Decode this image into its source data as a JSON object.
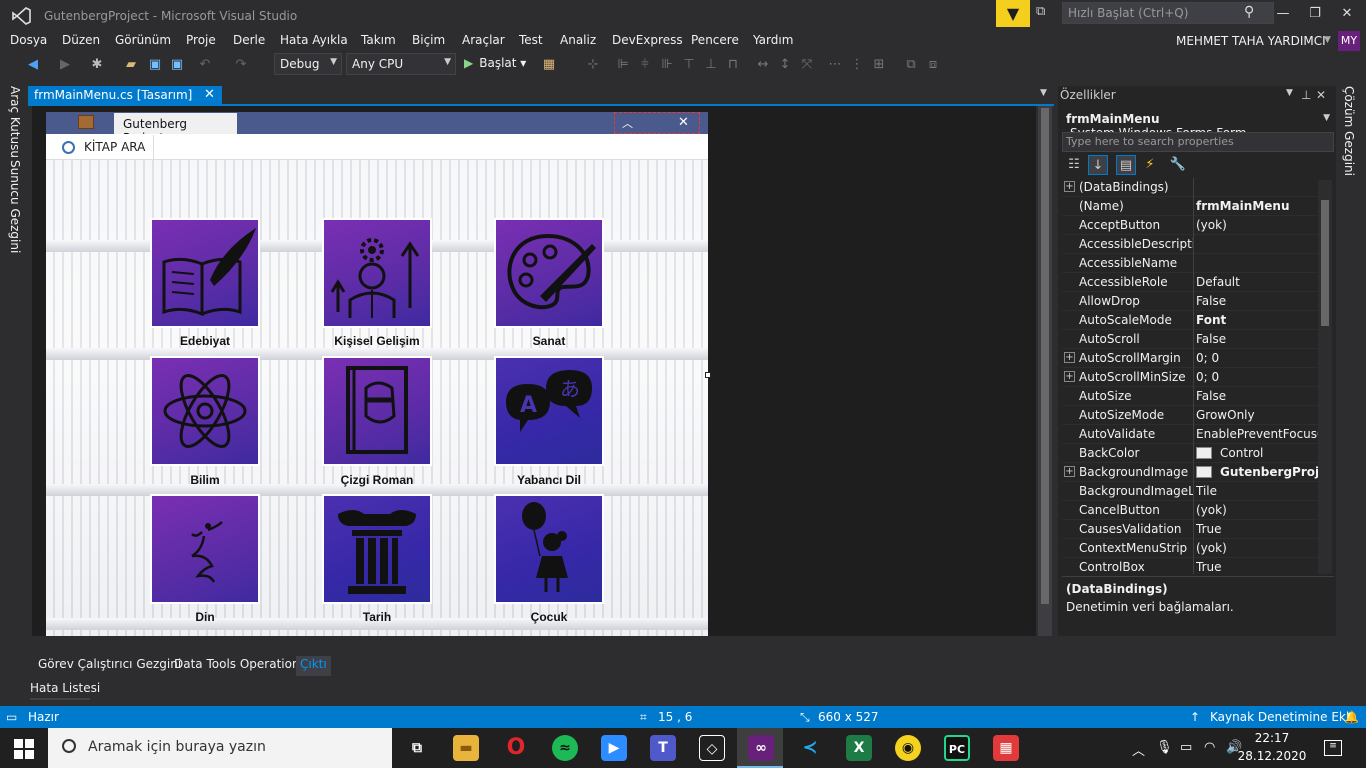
{
  "window": {
    "title": "GutenbergProject - Microsoft Visual Studio",
    "quick_launch_placeholder": "Hızlı Başlat (Ctrl+Q)",
    "user_name": "MEHMET TAHA YARDIMCI",
    "user_initials": "MY"
  },
  "menu": [
    "Dosya",
    "Düzen",
    "Görünüm",
    "Proje",
    "Derle",
    "Hata Ayıkla",
    "Takım",
    "Biçim",
    "Araçlar",
    "Test",
    "Analiz",
    "DevExpress",
    "Pencere",
    "Yardım"
  ],
  "toolbar": {
    "config": "Debug",
    "platform": "Any CPU",
    "run_label": "Başlat"
  },
  "side_tabs": {
    "left": [
      "Araç Kutusu",
      "Sunucu Gezgini"
    ],
    "right": [
      "Çözüm Gezgini"
    ]
  },
  "document_tab": {
    "label": "frmMainMenu.cs [Tasarım]"
  },
  "form": {
    "tab_title": "Gutenberg Project",
    "search_button": "KİTAP ARA",
    "categories": [
      {
        "label": "Edebiyat",
        "icon": "book-quill-icon"
      },
      {
        "label": "Kişisel Gelişim",
        "icon": "personal-growth-icon"
      },
      {
        "label": "Sanat",
        "icon": "palette-icon"
      },
      {
        "label": "Bilim",
        "icon": "atom-icon"
      },
      {
        "label": "Çizgi Roman",
        "icon": "comic-book-icon"
      },
      {
        "label": "Yabancı Dil",
        "icon": "language-bubbles-icon"
      },
      {
        "label": "Din",
        "icon": "whirling-dervish-icon"
      },
      {
        "label": "Tarih",
        "icon": "column-icon"
      },
      {
        "label": "Çocuk",
        "icon": "child-balloon-icon"
      }
    ]
  },
  "properties": {
    "header": "Özellikler",
    "object_name": "frmMainMenu",
    "object_type": "System.Windows.Forms.Form",
    "search_placeholder": "Type here to search properties",
    "rows": [
      {
        "name": "(DataBindings)",
        "value": "",
        "expandable": true
      },
      {
        "name": "(Name)",
        "value": "frmMainMenu",
        "bold": true
      },
      {
        "name": "AcceptButton",
        "value": "(yok)"
      },
      {
        "name": "AccessibleDescription",
        "value": ""
      },
      {
        "name": "AccessibleName",
        "value": ""
      },
      {
        "name": "AccessibleRole",
        "value": "Default"
      },
      {
        "name": "AllowDrop",
        "value": "False"
      },
      {
        "name": "AutoScaleMode",
        "value": "Font",
        "bold": true
      },
      {
        "name": "AutoScroll",
        "value": "False"
      },
      {
        "name": "AutoScrollMargin",
        "value": "0; 0",
        "expandable": true
      },
      {
        "name": "AutoScrollMinSize",
        "value": "0; 0",
        "expandable": true
      },
      {
        "name": "AutoSize",
        "value": "False"
      },
      {
        "name": "AutoSizeMode",
        "value": "GrowOnly"
      },
      {
        "name": "AutoValidate",
        "value": "EnablePreventFocusChange"
      },
      {
        "name": "BackColor",
        "value": "Control",
        "swatch": true
      },
      {
        "name": "BackgroundImage",
        "value": "GutenbergProject",
        "swatch": true,
        "bold": true,
        "expandable": true
      },
      {
        "name": "BackgroundImageLayout",
        "value": "Tile"
      },
      {
        "name": "CancelButton",
        "value": "(yok)"
      },
      {
        "name": "CausesValidation",
        "value": "True"
      },
      {
        "name": "ContextMenuStrip",
        "value": "(yok)"
      },
      {
        "name": "ControlBox",
        "value": "True"
      }
    ],
    "desc_title": "(DataBindings)",
    "desc_text": "Denetimin veri bağlamaları."
  },
  "bottom_tabs": [
    "Görev Çalıştırıcı Gezgini",
    "Data Tools Operations",
    "Çıktı"
  ],
  "error_list": "Hata Listesi",
  "status": {
    "ready": "Hazır",
    "position": "15 , 6",
    "size": "660 x 527",
    "source_control": "Kaynak Denetimine Ekle"
  },
  "taskbar": {
    "search_placeholder": "Aramak için buraya yazın",
    "time": "22:17",
    "date": "28.12.2020"
  },
  "colors": {
    "accent": "#007acc",
    "tile_purple": "#6a2fb0",
    "tile_blue": "#3a2aa8",
    "filter_yellow": "#f5cf1e"
  }
}
